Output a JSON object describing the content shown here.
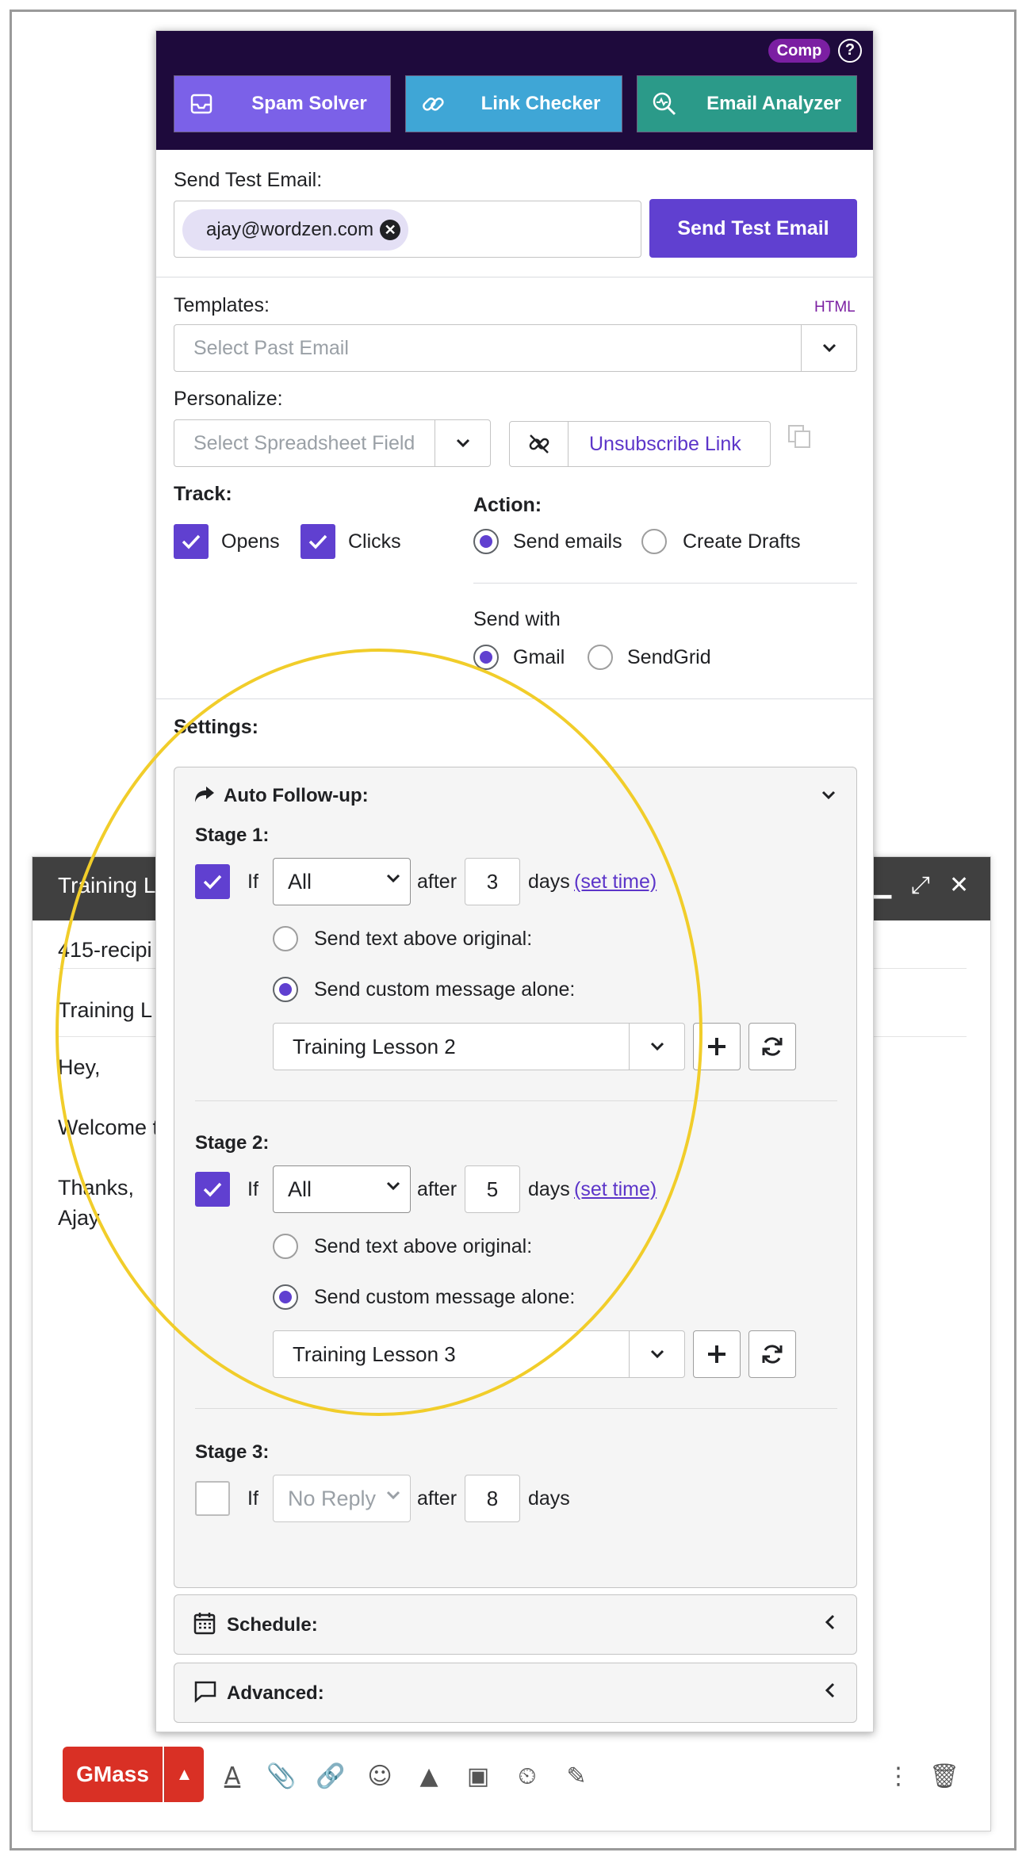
{
  "compose": {
    "title": "Training L",
    "to": "415-recipi",
    "subject": "Training L",
    "body_lines": [
      "Hey,",
      "Welcome t",
      "Thanks,",
      "Ajay"
    ],
    "send_button": "GMass"
  },
  "toolbar": {
    "badge": "Comp",
    "tools": [
      {
        "label": "Spam Solver",
        "icon": "inbox-icon",
        "color": "#7b61e8"
      },
      {
        "label": "Link Checker",
        "icon": "link-icon",
        "color": "#3fa6d6"
      },
      {
        "label": "Email Analyzer",
        "icon": "analyze-icon",
        "color": "#2b9a89"
      }
    ]
  },
  "test_email": {
    "label": "Send Test Email:",
    "address": "ajay@wordzen.com",
    "button": "Send Test Email"
  },
  "templates": {
    "label": "Templates:",
    "html_link": "HTML",
    "placeholder": "Select Past Email"
  },
  "personalize": {
    "label": "Personalize:",
    "placeholder": "Select Spreadsheet Field",
    "unsubscribe": "Unsubscribe Link"
  },
  "track": {
    "label": "Track:",
    "opens": "Opens",
    "clicks": "Clicks",
    "opens_checked": true,
    "clicks_checked": true
  },
  "action": {
    "label": "Action:",
    "send": "Send emails",
    "drafts": "Create Drafts",
    "selected": "send"
  },
  "send_with": {
    "label": "Send with",
    "gmail": "Gmail",
    "sendgrid": "SendGrid",
    "selected": "gmail"
  },
  "settings": {
    "label": "Settings:",
    "auto_followup": "Auto Follow-up:",
    "schedule": "Schedule:",
    "advanced": "Advanced:"
  },
  "stages": [
    {
      "title": "Stage 1:",
      "if": "If",
      "condition": "All",
      "after": "after",
      "days_value": "3",
      "days": "days",
      "set_time": "(set time)",
      "checked": true,
      "opt_above": "Send text above original:",
      "opt_alone": "Send custom message alone:",
      "message": "Training Lesson 2"
    },
    {
      "title": "Stage 2:",
      "if": "If",
      "condition": "All",
      "after": "after",
      "days_value": "5",
      "days": "days",
      "set_time": "(set time)",
      "checked": true,
      "opt_above": "Send text above original:",
      "opt_alone": "Send custom message alone:",
      "message": "Training Lesson 3"
    },
    {
      "title": "Stage 3:",
      "if": "If",
      "condition": "No Reply",
      "after": "after",
      "days_value": "8",
      "days": "days",
      "checked": false
    }
  ],
  "colors": {
    "accent": "#6040d0",
    "header": "#1e0a3c",
    "highlight": "#f1cd2a",
    "gmass_red": "#d93025"
  }
}
